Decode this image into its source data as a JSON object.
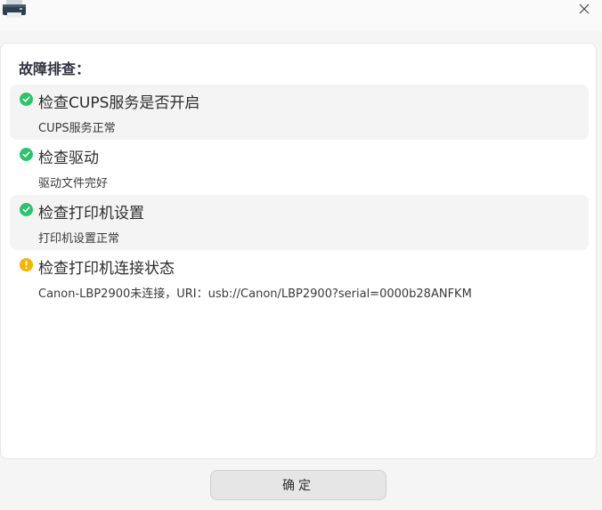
{
  "window": {
    "app_icon": "printer-icon",
    "close_icon": "close-icon"
  },
  "panel": {
    "title": "故障排查："
  },
  "checks": [
    {
      "title": "检查CUPS服务是否开启",
      "desc": "CUPS服务正常",
      "status": "ok"
    },
    {
      "title": "检查驱动",
      "desc": "驱动文件完好",
      "status": "ok"
    },
    {
      "title": "检查打印机设置",
      "desc": "打印机设置正常",
      "status": "ok"
    },
    {
      "title": "检查打印机连接状态",
      "desc": "Canon-LBP2900未连接，URI：usb://Canon/LBP2900?serial=0000b28ANFKM",
      "status": "warning"
    }
  ],
  "footer": {
    "confirm_label": "确定"
  },
  "colors": {
    "ok": "#2cc46b",
    "warning": "#f4b400"
  }
}
